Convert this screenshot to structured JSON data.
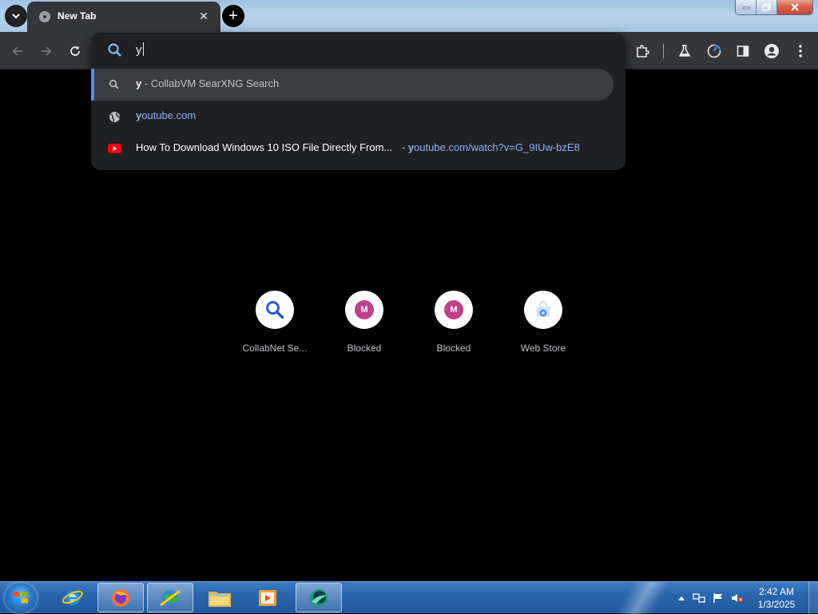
{
  "window": {
    "tab_title": "New Tab",
    "tab_close": "✕",
    "new_tab": "+"
  },
  "omnibox": {
    "input_value": "y",
    "suggestions": [
      {
        "kind": "search",
        "icon": "search-icon",
        "match": "y",
        "rest": " - CollabVM SearXNG Search"
      },
      {
        "kind": "url",
        "icon": "globe-icon",
        "match": "y",
        "rest": "outube.com"
      },
      {
        "kind": "history",
        "icon": "youtube-icon",
        "title": "How To Download Windows 10 ISO File Directly From...",
        "sep": " - ",
        "match": "y",
        "rest": "outube.com/watch?v=G_9IUw-bzE8"
      }
    ]
  },
  "shortcuts": [
    {
      "label": "CollabNet Se...",
      "icon": "search-icon"
    },
    {
      "label": "Blocked",
      "icon": "m-letter-icon",
      "letter": "M"
    },
    {
      "label": "Blocked",
      "icon": "m-letter-icon",
      "letter": "M"
    },
    {
      "label": "Web Store",
      "icon": "web-store-icon"
    }
  ],
  "taskbar": {
    "items": [
      "internet-explorer-icon",
      "firefox-icon",
      "network-globe-icon",
      "file-explorer-icon",
      "media-player-icon",
      "browser-app-icon"
    ],
    "time": "2:42 AM",
    "date": "1/3/2025"
  },
  "colors": {
    "accent": "#4c8df6",
    "link": "#8ab4f8",
    "toolbar": "#35363a",
    "dropdown": "#1f2023",
    "badge": "#c0408a"
  }
}
